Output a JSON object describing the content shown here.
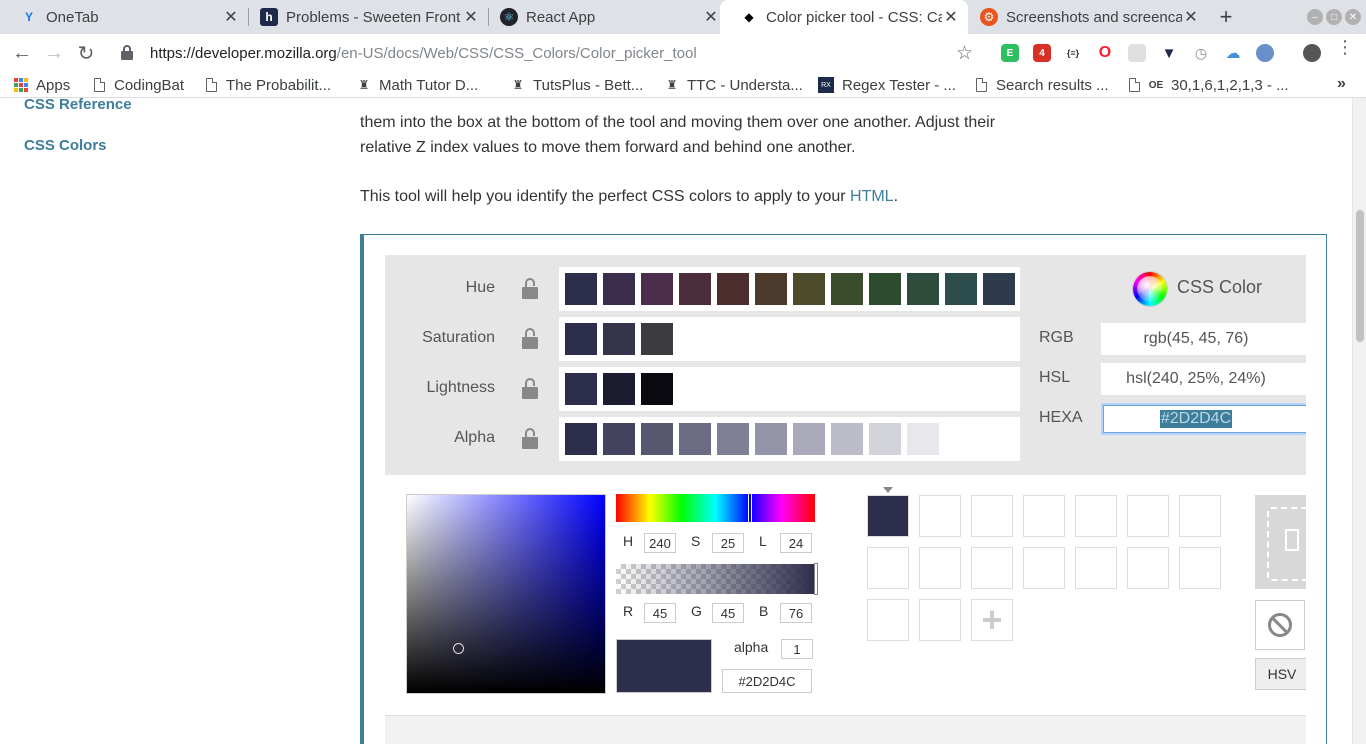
{
  "tabs": [
    {
      "title": "OneTab",
      "favicon": "Y",
      "favicon_color": "#1a73e8"
    },
    {
      "title": "Problems - Sweeten Front",
      "favicon": "h",
      "favicon_color": "#1e2a4a"
    },
    {
      "title": "React App",
      "favicon": "⚛",
      "favicon_color": "#61dafb"
    },
    {
      "title": "Color picker tool - CSS: Ca",
      "favicon": "◆",
      "favicon_color": "#000000",
      "active": true
    },
    {
      "title": "Screenshots and screenca",
      "favicon": "⚙",
      "favicon_color": "#e95420"
    }
  ],
  "toolbar": {
    "url_host": "https://developer.mozilla.org",
    "url_path": "/en-US/docs/Web/CSS/CSS_Colors/Color_picker_tool",
    "extension_badge": "4"
  },
  "bookmarks": [
    {
      "label": "Apps",
      "icon": "apps-grid-icon"
    },
    {
      "label": "CodingBat",
      "icon": "doc-icon"
    },
    {
      "label": "The Probabilit...",
      "icon": "doc-icon"
    },
    {
      "label": "Math Tutor D...",
      "icon": "tuts-icon"
    },
    {
      "label": "TutsPlus - Bett...",
      "icon": "tuts-icon"
    },
    {
      "label": "TTC - Understa...",
      "icon": "tuts-icon"
    },
    {
      "label": "Regex Tester - ...",
      "icon": "regex-icon"
    },
    {
      "label": "Search results ...",
      "icon": "doc-icon"
    },
    {
      "label": "30,1,6,1,2,1,3 - ...",
      "icon": "oeis-icon"
    }
  ],
  "sidebar": {
    "reference_link": "CSS Reference",
    "colors_link": "CSS Colors"
  },
  "content": {
    "para1_line1": "them into the box at the bottom of the tool and moving them over one another. Adjust their",
    "para1_line2": "relative Z index values to move them forward and behind one another.",
    "para2_text": "This tool will help you identify the perfect CSS colors to apply to your ",
    "para2_link": "HTML",
    "para2_end": "."
  },
  "palette": {
    "rows": [
      {
        "label": "Hue",
        "swatches": [
          "#2d2d4c",
          "#3b2d4c",
          "#4c2d4c",
          "#4c2d3b",
          "#4c2d2d",
          "#4c3b2d",
          "#4c4c2d",
          "#3b4c2d",
          "#2d4c2d",
          "#2d4c3b",
          "#2d4c4c",
          "#2d3b4c"
        ]
      },
      {
        "label": "Saturation",
        "swatches": [
          "#2d2d4c",
          "#33334a",
          "#3a3a3f"
        ]
      },
      {
        "label": "Lightness",
        "swatches": [
          "#2d2d4c",
          "#1c1c30",
          "#0a0a10"
        ]
      },
      {
        "label": "Alpha",
        "swatches": [
          "#2d2d4c",
          "#434360",
          "#57576f",
          "#6b6b83",
          "#7f7f95",
          "#9494a8",
          "#a9a9b9",
          "#bdbdca",
          "#d3d3dc",
          "#e8e8ec"
        ]
      }
    ],
    "css_color_title": "CSS Color",
    "rgb_label": "RGB",
    "rgb_value": "rgb(45, 45, 76)",
    "hsl_label": "HSL",
    "hsl_value": "hsl(240, 25%, 24%)",
    "hexa_label": "HEXA",
    "hexa_value": "#2D2D4C"
  },
  "picker": {
    "h_label": "H",
    "h": "240",
    "s_label": "S",
    "s": "25",
    "l_label": "L",
    "l": "24",
    "r_label": "R",
    "r": "45",
    "g_label": "G",
    "g": "45",
    "b_label": "B",
    "b": "76",
    "alpha_label": "alpha",
    "alpha": "1",
    "hex": "#2D2D4C",
    "preview_color": "#2d2d4c"
  },
  "saved": {
    "first_color": "#2d2d4c",
    "add_label": "+",
    "mode_button": "HSV"
  }
}
